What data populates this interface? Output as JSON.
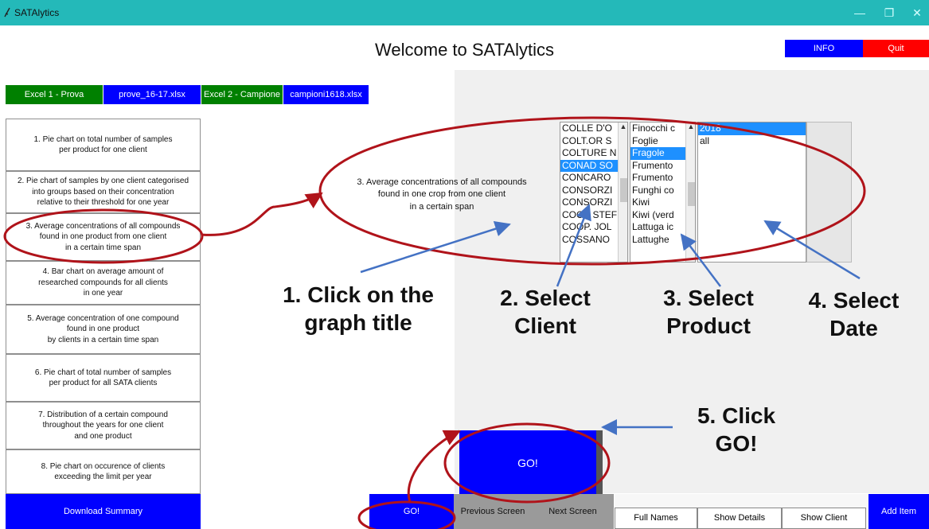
{
  "window": {
    "title": "SATAlytics",
    "min_glyph": "—",
    "max_glyph": "❐",
    "close_glyph": "✕"
  },
  "header": {
    "welcome": "Welcome to SATAlytics",
    "info_label": "INFO",
    "quit_label": "Quit"
  },
  "excel": {
    "excel1_label": "Excel 1 - Prova",
    "excel1_file": "prove_16-17.xlsx",
    "excel2_label": "Excel 2 - Campione",
    "excel2_file": "campioni1618.xlsx"
  },
  "menu": [
    "1. Pie chart on total number of samples\nper product for one client",
    "2. Pie chart of samples by one client categorised\ninto groups based on their concentration\nrelative to their threshold for one year",
    "3. Average concentrations of all compounds\nfound in one product from one client\nin a certain time span",
    "4. Bar chart on average amount of\nresearched compounds for all clients\nin one year",
    "5. Average concentration of one compound\nfound in one product\nby clients in a certain time span",
    "6. Pie chart of total number of samples\nper product for all SATA clients",
    "7. Distribution of a certain compound\nthroughout the years for one client\nand one product",
    "8. Pie chart on occurence of clients\nexceeding the limit per year"
  ],
  "download_label": "Download Summary",
  "selected_graph_title": "3. Average concentrations of all compounds\nfound in one crop from one client\nin a certain span",
  "clients": [
    "COLLE D'O",
    "COLT.OR S",
    "COLTURE N",
    "CONAD SO",
    "CONCARO",
    "CONSORZI",
    "CONSORZI",
    "COOP STEF",
    "COOP. JOL",
    "COSSANO"
  ],
  "clients_selected_index": 3,
  "products": [
    "Finocchi c",
    "Foglie",
    "Fragole",
    "Frumento",
    "Frumento",
    "Funghi co",
    "Kiwi",
    "Kiwi (verd",
    "Lattuga ic",
    "Lattughe"
  ],
  "products_selected_index": 2,
  "dates": [
    "2018",
    "all"
  ],
  "dates_selected_index": 0,
  "annotations": {
    "step1": "1. Click on the\ngraph title",
    "step2": "2. Select\nClient",
    "step3": "3. Select\nProduct",
    "step4": "4. Select\nDate",
    "step5": "5. Click\nGO!"
  },
  "go_big_label": "GO!",
  "bottom": {
    "go_label": "GO!",
    "prev_label": "Previous Screen",
    "next_label": "Next Screen",
    "full_names_label": "Full Names",
    "show_details_label": "Show Details",
    "show_client_label": "Show Client",
    "add_item_label": "Add Item"
  },
  "colors": {
    "titlebar": "#24b9b9",
    "blue": "#0000ff",
    "red": "#ff0000",
    "green": "#008000",
    "annotation": "#b0131a",
    "arrow": "#4472c4"
  }
}
